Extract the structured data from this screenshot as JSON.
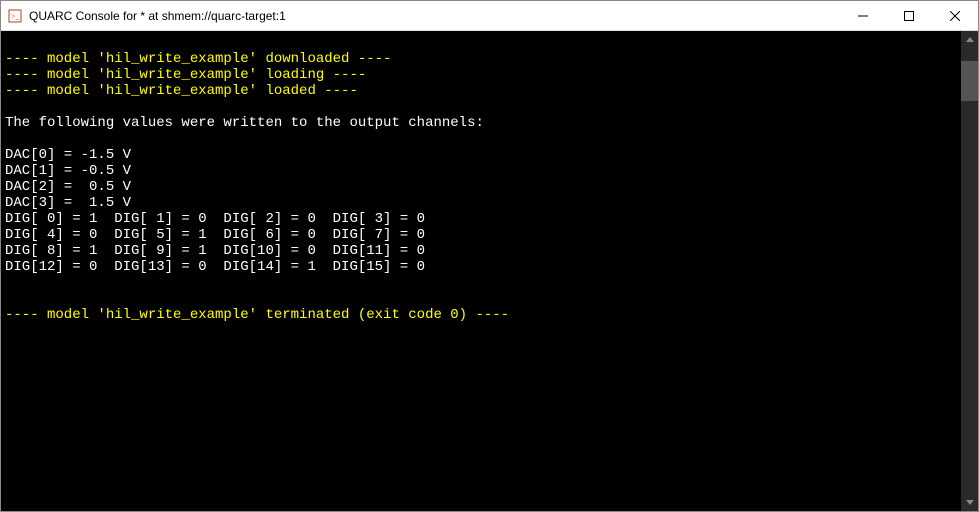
{
  "titlebar": {
    "title": "QUARC Console for * at shmem://quarc-target:1"
  },
  "console": {
    "lines": [
      {
        "text": "",
        "class": ""
      },
      {
        "text": "---- model 'hil_write_example' downloaded ----",
        "class": "yellow"
      },
      {
        "text": "---- model 'hil_write_example' loading ----",
        "class": "yellow"
      },
      {
        "text": "---- model 'hil_write_example' loaded ----",
        "class": "yellow"
      },
      {
        "text": "",
        "class": ""
      },
      {
        "text": "The following values were written to the output channels:",
        "class": ""
      },
      {
        "text": "",
        "class": ""
      },
      {
        "text": "DAC[0] = -1.5 V",
        "class": ""
      },
      {
        "text": "DAC[1] = -0.5 V",
        "class": ""
      },
      {
        "text": "DAC[2] =  0.5 V",
        "class": ""
      },
      {
        "text": "DAC[3] =  1.5 V",
        "class": ""
      },
      {
        "text": "DIG[ 0] = 1  DIG[ 1] = 0  DIG[ 2] = 0  DIG[ 3] = 0",
        "class": ""
      },
      {
        "text": "DIG[ 4] = 0  DIG[ 5] = 1  DIG[ 6] = 0  DIG[ 7] = 0",
        "class": ""
      },
      {
        "text": "DIG[ 8] = 1  DIG[ 9] = 1  DIG[10] = 0  DIG[11] = 0",
        "class": ""
      },
      {
        "text": "DIG[12] = 0  DIG[13] = 0  DIG[14] = 1  DIG[15] = 0",
        "class": ""
      },
      {
        "text": "",
        "class": ""
      },
      {
        "text": "",
        "class": ""
      },
      {
        "text": "---- model 'hil_write_example' terminated (exit code 0) ----",
        "class": "yellow"
      }
    ]
  }
}
